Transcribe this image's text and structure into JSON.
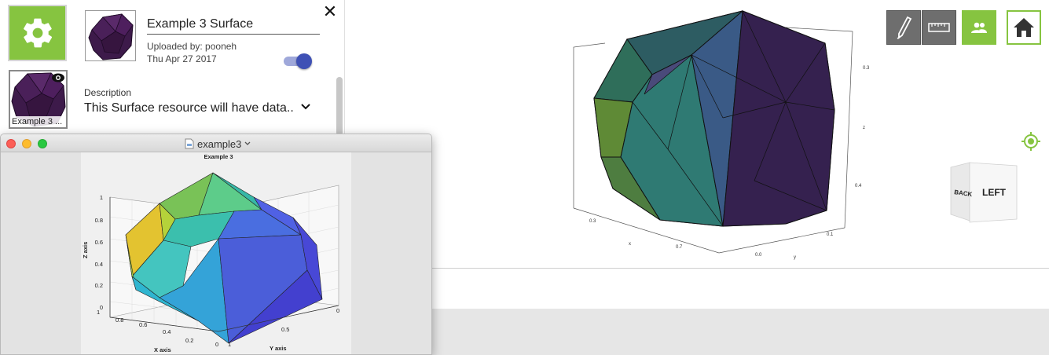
{
  "sidebar": {
    "settings_icon": "gear-icon",
    "thumbnail_caption": "Example 3 ...",
    "thumbnail_badge_icon": "eye-icon"
  },
  "details": {
    "title_value": "Example 3 Surface",
    "uploaded_by": "Uploaded by: pooneh",
    "date": "Thu Apr 27 2017",
    "description_label": "Description",
    "description_text": "This Surface resource will have data..",
    "close_icon": "close-icon",
    "visibility_toggle_on": true
  },
  "toolbar": {
    "annotate_icon": "pen-icon",
    "measure_icon": "ruler-icon",
    "share_icon": "people-icon",
    "home_icon": "home-icon",
    "locate_icon": "crosshair-icon"
  },
  "view_cube": {
    "face_left": "LEFT",
    "face_back": "BACK"
  },
  "mac_window": {
    "title": "example3"
  },
  "plot": {
    "title": "Example 3",
    "xlabel": "X axis",
    "ylabel": "Y axis",
    "zlabel": "Z axis",
    "z_ticks": [
      "1",
      "0.8",
      "0.6",
      "0.4",
      "0.2",
      "0"
    ],
    "x_ticks": [
      "1",
      "0.8",
      "0.6",
      "0.4",
      "0.2",
      "0"
    ],
    "y_ticks": [
      "1",
      "0.5",
      "0"
    ]
  },
  "viewer_axes": {
    "tick_labels": [
      "0.3",
      "x",
      "0.7",
      "0.0",
      "y",
      "0.1",
      "0.3",
      "z",
      "0.4"
    ]
  },
  "colors": {
    "accent_green": "#86c440",
    "toggle_blue": "#3f51b5",
    "tool_gray": "#6e6e6e"
  }
}
